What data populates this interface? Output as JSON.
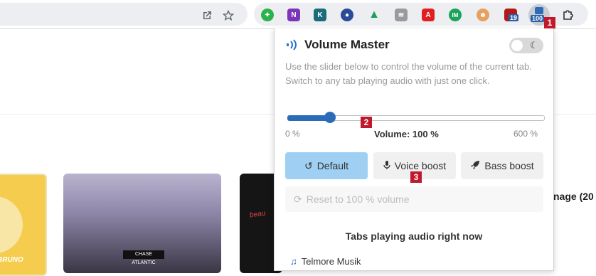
{
  "toolbar": {
    "open_icon": "open-in-new-icon",
    "star_icon": "bookmark-star-icon",
    "extensions": [
      {
        "name": "evernote-icon",
        "color": "#2bb24c",
        "glyph": "✦"
      },
      {
        "name": "onenote-icon",
        "color": "#7b35b8",
        "glyph": "N"
      },
      {
        "name": "k-app-icon",
        "color": "#1a6c7a",
        "glyph": "K"
      },
      {
        "name": "blue-circle-icon",
        "color": "#2a4a9a",
        "glyph": "●"
      },
      {
        "name": "google-drive-icon",
        "color": "#f4b400",
        "glyph": "▲"
      },
      {
        "name": "rss-icon",
        "color": "#8a8a8a",
        "glyph": "≋"
      },
      {
        "name": "acrobat-icon",
        "color": "#e02020",
        "glyph": "A"
      },
      {
        "name": "im-icon",
        "color": "#1aa35a",
        "glyph": "IM"
      },
      {
        "name": "face-icon",
        "color": "#e27a4b",
        "glyph": "☻"
      },
      {
        "name": "shield-icon",
        "color": "#b01a1a",
        "glyph": "⛨"
      },
      {
        "name": "volume-master-icon",
        "color": "#2b6cb8",
        "glyph": "◧"
      },
      {
        "name": "puzzle-icon",
        "color": "#333333",
        "glyph": "⧉"
      }
    ],
    "shield_badge": "19",
    "volume_badge": "100"
  },
  "page": {
    "card1_text": "BRUNO",
    "card2_band": "CHASE ATLANTIC",
    "card3_text": "beau",
    "right_text": "nage (20"
  },
  "popup": {
    "title": "Volume Master",
    "description": "Use the slider below to control the volume of the current tab. Switch to any tab playing audio with just one click.",
    "theme_icon": "moon-icon",
    "volume_percent": 100,
    "volume_max": 600,
    "label_min": "0 %",
    "label_current": "Volume: 100 %",
    "label_max": "600 %",
    "buttons": {
      "default": "Default",
      "voice": "Voice boost",
      "bass": "Bass boost",
      "reset": "Reset to 100 % volume"
    },
    "section_title": "Tabs playing audio right now",
    "tabs": [
      {
        "title": "Telmore Musik"
      }
    ]
  },
  "markers": [
    "1",
    "2",
    "3"
  ],
  "colors": {
    "accent": "#2b6cb8",
    "default_button": "#9fd0f3",
    "marker": "#c0192b"
  }
}
